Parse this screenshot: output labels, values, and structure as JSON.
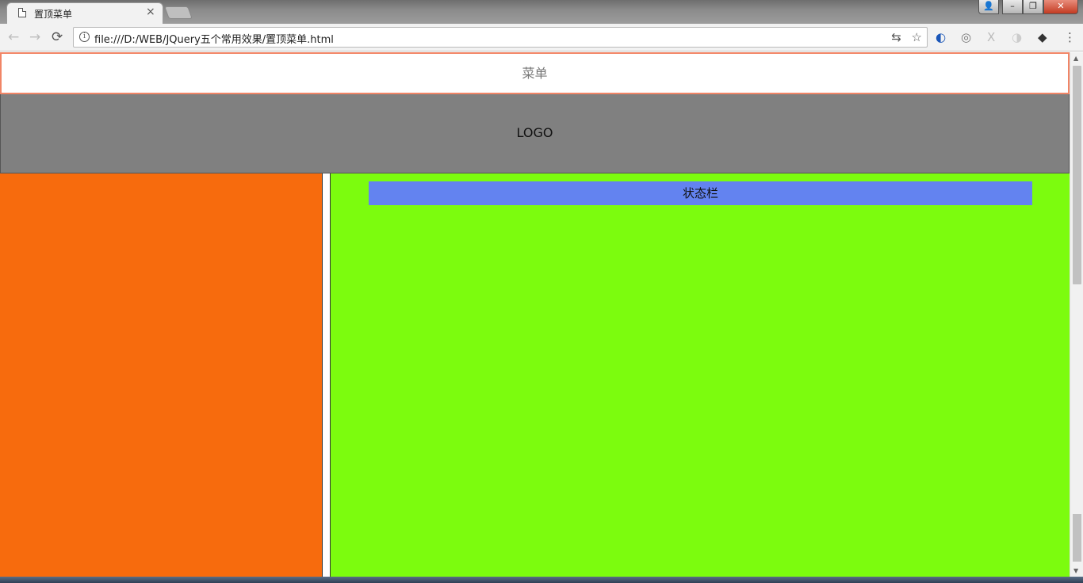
{
  "browser": {
    "tab_title": "置顶菜单",
    "tab_close": "×",
    "url": "file:///D:/WEB/JQuery五个常用效果/置顶菜单.html",
    "nav": {
      "back": "←",
      "forward": "→",
      "reload": "⟳"
    },
    "info_icon": "i",
    "omnibox_icons": {
      "translate": "⇆",
      "bookmark": "☆"
    },
    "extensions": [
      "◐",
      "◎",
      "X",
      "◑",
      "◆"
    ],
    "menu_icon": "⋮",
    "window_buttons": {
      "user": "👤",
      "minimize": "–",
      "maximize": "❐",
      "close": "✕"
    }
  },
  "page": {
    "menu_text": "菜单",
    "logo_text": "LOGO",
    "status_text": "状态栏"
  },
  "scrollbar": {
    "up": "▲",
    "down": "▼"
  },
  "colors": {
    "menu_border": "#f18566",
    "logo_bg": "#808080",
    "left_col": "#f76b0d",
    "right_col": "#7cfc0e",
    "status_bar": "#6383f0"
  }
}
